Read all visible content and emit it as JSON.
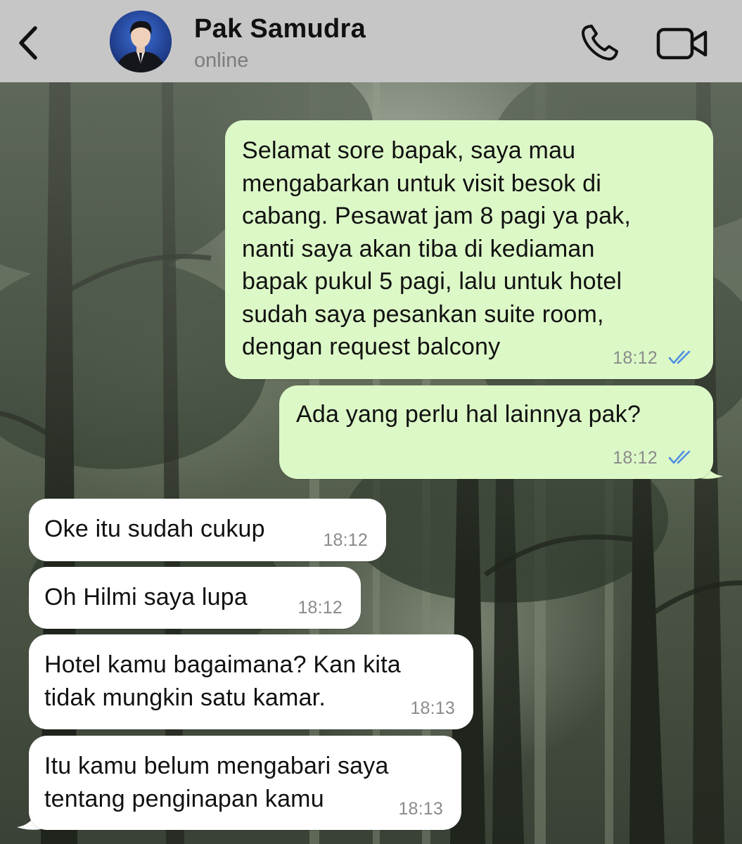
{
  "header": {
    "contact_name": "Pak Samudra",
    "status": "online",
    "icons": [
      "chevron-left-icon",
      "phone-icon",
      "video-camera-icon"
    ]
  },
  "colors": {
    "header_bg": "#c6c6c6",
    "outgoing_bubble": "#dcf8c7",
    "incoming_bubble": "#ffffff",
    "read_ticks": "#4f8fe0",
    "timestamp": "#8b8b8b"
  },
  "messages": [
    {
      "direction": "outgoing",
      "lines": [
        "Selamat sore bapak, saya mau",
        "mengabarkan untuk visit besok di",
        "cabang. Pesawat jam 8 pagi ya pak,",
        "nanti saya akan tiba di kediaman",
        "bapak pukul 5 pagi, lalu untuk hotel",
        "sudah saya pesankan suite room,",
        "dengan request balcony"
      ],
      "time": "18:12",
      "status": "read"
    },
    {
      "direction": "outgoing",
      "lines": [
        "Ada yang perlu hal lainnya pak?"
      ],
      "time": "18:12",
      "status": "read"
    },
    {
      "direction": "incoming",
      "lines": [
        "Oke itu sudah cukup"
      ],
      "time": "18:12"
    },
    {
      "direction": "incoming",
      "lines": [
        "Oh Hilmi saya lupa"
      ],
      "time": "18:12"
    },
    {
      "direction": "incoming",
      "lines": [
        "Hotel kamu bagaimana? Kan kita",
        "tidak mungkin satu kamar."
      ],
      "time": "18:13"
    },
    {
      "direction": "incoming",
      "lines": [
        "Itu kamu belum mengabari saya",
        "tentang penginapan kamu"
      ],
      "time": "18:13"
    }
  ]
}
